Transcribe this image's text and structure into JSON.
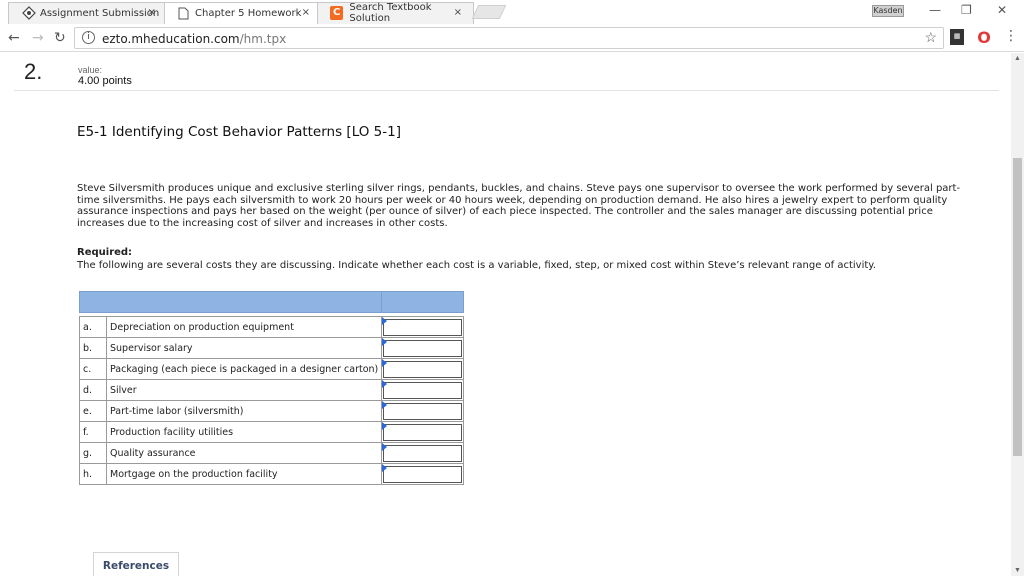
{
  "browser": {
    "tabs": [
      {
        "title": "Assignment Submission",
        "icon": "mheducation-logo-icon"
      },
      {
        "title": "Chapter 5 Homework",
        "icon": "page-icon"
      },
      {
        "title": "Search Textbook Solution",
        "icon": "chegg-icon"
      }
    ],
    "tab_close": "×",
    "profile_label": "Kasden",
    "window_minimize": "—",
    "window_restore": "❐",
    "window_close": "✕",
    "url_host": "ezto.mheducation.com",
    "url_path": "/hm.tpx"
  },
  "question": {
    "number": "2.",
    "value_label": "value:",
    "points": "4.00 points",
    "title": "E5-1 Identifying Cost Behavior Patterns [LO 5-1]",
    "body": "Steve Silversmith produces unique and exclusive sterling silver rings, pendants, buckles, and chains. Steve pays one supervisor to oversee the work performed by several part-time silversmiths. He pays each silversmith to work 20 hours per week or 40 hours week, depending on production demand. He also hires a jewelry expert to perform quality assurance inspections and pays her based on the weight (per ounce of silver) of each piece inspected. The controller and the sales manager are discussing potential price increases due to the increasing cost of silver and increases in other costs.",
    "required_label": "Required:",
    "required_text": "The following are several costs they are discussing. Indicate whether each cost is a variable, fixed, step, or mixed cost within Steve’s relevant range of activity."
  },
  "cost_items": [
    {
      "letter": "a.",
      "description": "Depreciation on production equipment",
      "answer": ""
    },
    {
      "letter": "b.",
      "description": "Supervisor salary",
      "answer": ""
    },
    {
      "letter": "c.",
      "description": "Packaging (each piece is packaged in a designer carton)",
      "answer": ""
    },
    {
      "letter": "d.",
      "description": "Silver",
      "answer": ""
    },
    {
      "letter": "e.",
      "description": "Part-time labor (silversmith)",
      "answer": ""
    },
    {
      "letter": "f.",
      "description": "Production facility utilities",
      "answer": ""
    },
    {
      "letter": "g.",
      "description": "Quality assurance",
      "answer": ""
    },
    {
      "letter": "h.",
      "description": "Mortgage on the production facility",
      "answer": ""
    }
  ],
  "references_label": "References",
  "colors": {
    "table_header": "#8fb4e4",
    "dropdown_marker": "#2a6ad8",
    "chegg_orange": "#f26b21"
  }
}
